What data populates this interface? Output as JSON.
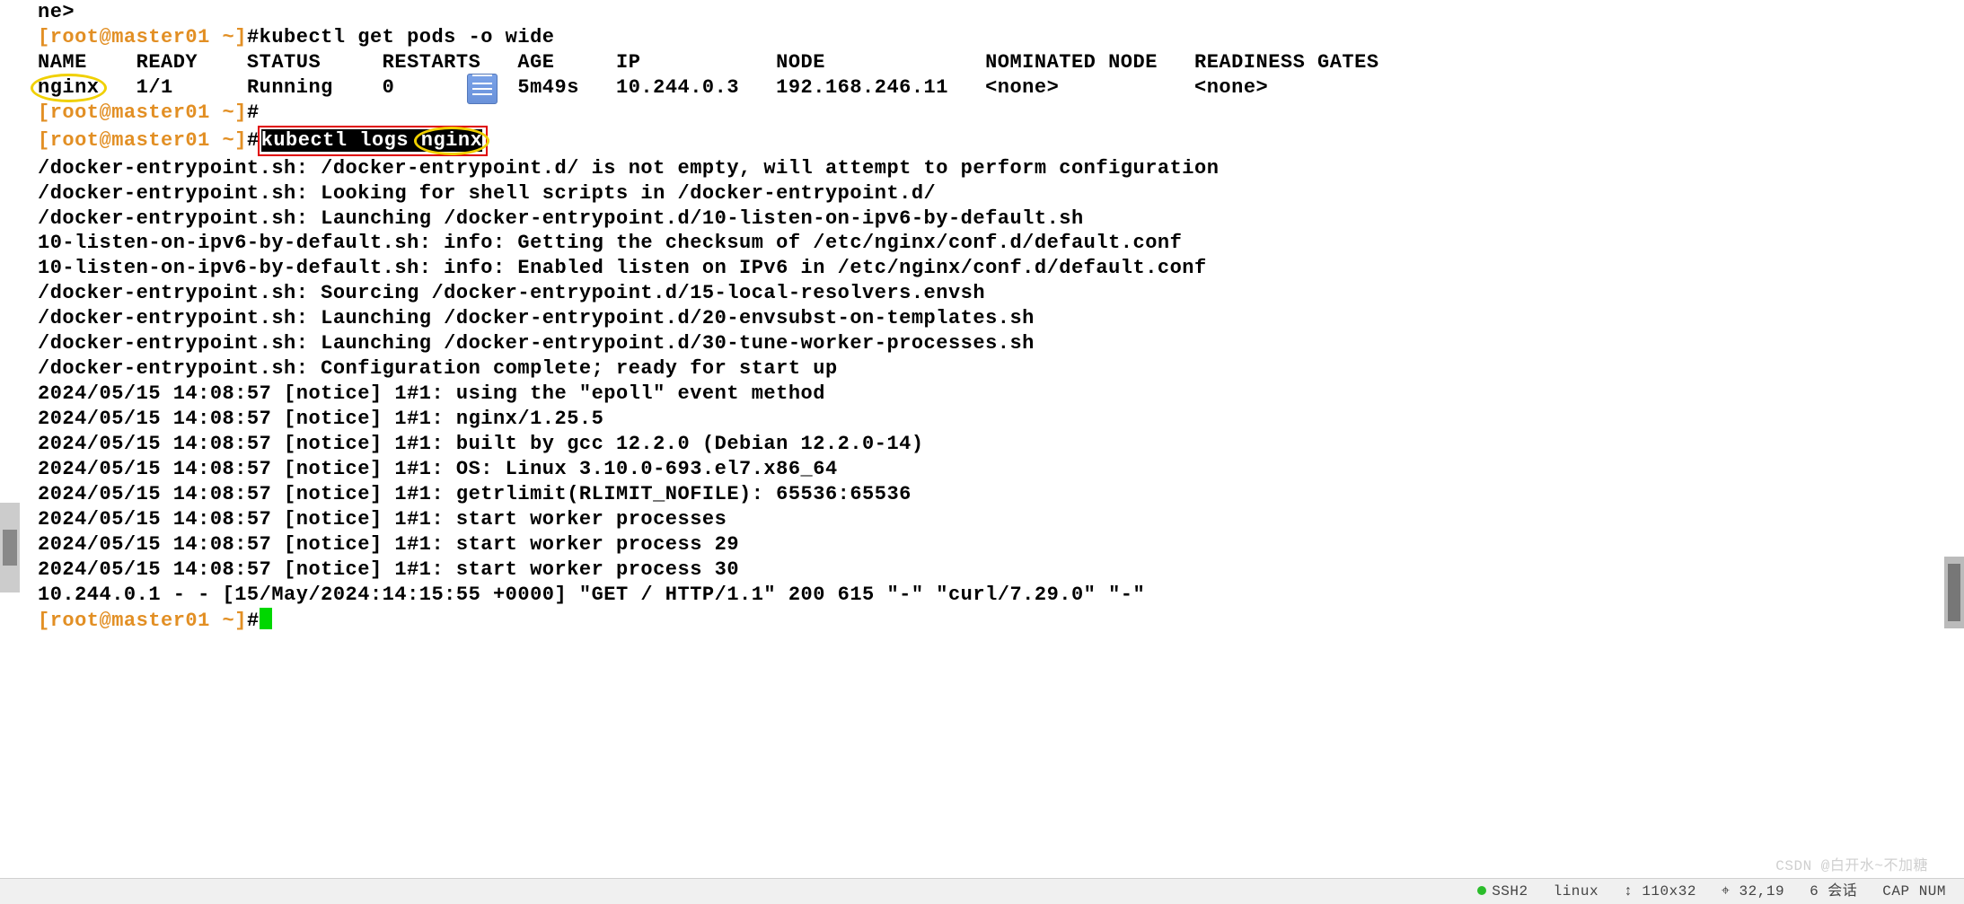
{
  "top_fragment": "ne>",
  "prompt": {
    "user": "[root@master01 ~]",
    "pound": "#"
  },
  "cmd_get_pods": "kubectl get pods -o wide",
  "pods_table": {
    "headers": [
      "NAME",
      "READY",
      "STATUS",
      "RESTARTS",
      "AGE",
      "IP",
      "NODE",
      "NOMINATED NODE",
      "READINESS GATES"
    ],
    "rows": [
      {
        "NAME": "nginx",
        "READY": "1/1",
        "STATUS": "Running",
        "RESTARTS": "0",
        "AGE": "5m49s",
        "IP": "10.244.0.3",
        "NODE": "192.168.246.11",
        "NOMINATED NODE": "<none>",
        "READINESS GATES": "<none>"
      }
    ]
  },
  "cmd_logs": {
    "left": "kubectl logs ",
    "arg": "nginx"
  },
  "log_lines": [
    "/docker-entrypoint.sh: /docker-entrypoint.d/ is not empty, will attempt to perform configuration",
    "/docker-entrypoint.sh: Looking for shell scripts in /docker-entrypoint.d/",
    "/docker-entrypoint.sh: Launching /docker-entrypoint.d/10-listen-on-ipv6-by-default.sh",
    "10-listen-on-ipv6-by-default.sh: info: Getting the checksum of /etc/nginx/conf.d/default.conf",
    "10-listen-on-ipv6-by-default.sh: info: Enabled listen on IPv6 in /etc/nginx/conf.d/default.conf",
    "/docker-entrypoint.sh: Sourcing /docker-entrypoint.d/15-local-resolvers.envsh",
    "/docker-entrypoint.sh: Launching /docker-entrypoint.d/20-envsubst-on-templates.sh",
    "/docker-entrypoint.sh: Launching /docker-entrypoint.d/30-tune-worker-processes.sh",
    "/docker-entrypoint.sh: Configuration complete; ready for start up",
    "2024/05/15 14:08:57 [notice] 1#1: using the \"epoll\" event method",
    "2024/05/15 14:08:57 [notice] 1#1: nginx/1.25.5",
    "2024/05/15 14:08:57 [notice] 1#1: built by gcc 12.2.0 (Debian 12.2.0-14)",
    "2024/05/15 14:08:57 [notice] 1#1: OS: Linux 3.10.0-693.el7.x86_64",
    "2024/05/15 14:08:57 [notice] 1#1: getrlimit(RLIMIT_NOFILE): 65536:65536",
    "2024/05/15 14:08:57 [notice] 1#1: start worker processes",
    "2024/05/15 14:08:57 [notice] 1#1: start worker process 29",
    "2024/05/15 14:08:57 [notice] 1#1: start worker process 30",
    "10.244.0.1 - - [15/May/2024:14:15:55 +0000] \"GET / HTTP/1.1\" 200 615 \"-\" \"curl/7.29.0\" \"-\""
  ],
  "col_widths": {
    "NAME": 8,
    "READY": 9,
    "STATUS": 11,
    "RESTARTS": 11,
    "AGE": 8,
    "IP": 13,
    "NODE": 17,
    "NOMINATED NODE": 17,
    "READINESS GATES": 16
  },
  "status_bar": {
    "proto": "SSH2",
    "os": "linux",
    "size": "110x32",
    "pos": "32,19",
    "sess": "6 会话",
    "caps": "CAP  NUM"
  },
  "watermark": "CSDN @白开水~不加糖"
}
